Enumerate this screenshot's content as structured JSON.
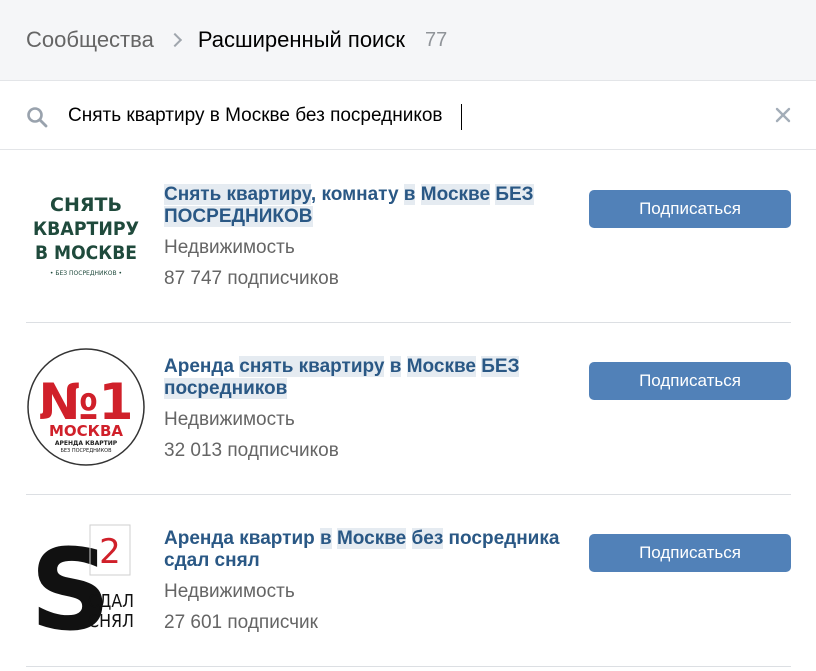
{
  "header": {
    "root": "Сообщества",
    "current": "Расширенный поиск",
    "count": "77"
  },
  "search": {
    "value": "Снять квартиру в Москве без посредников"
  },
  "results": [
    {
      "title_parts": [
        {
          "text": "Снять квартиру",
          "hl": true
        },
        {
          "text": ", комнату ",
          "hl": false
        },
        {
          "text": "в",
          "hl": true
        },
        {
          "text": " ",
          "hl": false
        },
        {
          "text": "Москве",
          "hl": true
        },
        {
          "text": " ",
          "hl": false
        },
        {
          "text": "БЕЗ ПОСРЕДНИКОВ",
          "hl": true
        }
      ],
      "category": "Недвижимость",
      "subscribers": "87 747 подписчиков",
      "button": "Подписаться",
      "logo": {
        "lines": [
          "СНЯТЬ",
          "КВАРТИРУ",
          "В МОСКВЕ"
        ],
        "tagline": "• БЕЗ ПОСРЕДНИКОВ •",
        "color": "#1f4a3c"
      }
    },
    {
      "title_parts": [
        {
          "text": "Аренда ",
          "hl": false
        },
        {
          "text": "снять квартиру",
          "hl": true
        },
        {
          "text": " ",
          "hl": false
        },
        {
          "text": "в",
          "hl": true
        },
        {
          "text": " ",
          "hl": false
        },
        {
          "text": "Москве",
          "hl": true
        },
        {
          "text": " ",
          "hl": false
        },
        {
          "text": "БЕЗ посредников",
          "hl": true
        }
      ],
      "category": "Недвижимость",
      "subscribers": "32 013 подписчиков",
      "button": "Подписаться",
      "logo": {
        "big": "№1",
        "word": "МОСКВА",
        "small1": "АРЕНДА КВАРТИР",
        "small2": "БЕЗ ПОСРЕДНИКОВ",
        "color": "#d0202a"
      }
    },
    {
      "title_parts": [
        {
          "text": "Аренда квартир ",
          "hl": false
        },
        {
          "text": "в",
          "hl": true
        },
        {
          "text": " ",
          "hl": false
        },
        {
          "text": "Москве",
          "hl": true
        },
        {
          "text": " ",
          "hl": false
        },
        {
          "text": "без",
          "hl": true
        },
        {
          "text": " посредника сдал снял",
          "hl": false
        }
      ],
      "category": "Недвижимость",
      "subscribers": "27 601 подписчик",
      "button": "Подписаться",
      "logo": {
        "letter": "S",
        "num": "2",
        "word1": "СДАЛ",
        "word2": "СНЯЛ",
        "color": "#d0202a"
      }
    }
  ]
}
